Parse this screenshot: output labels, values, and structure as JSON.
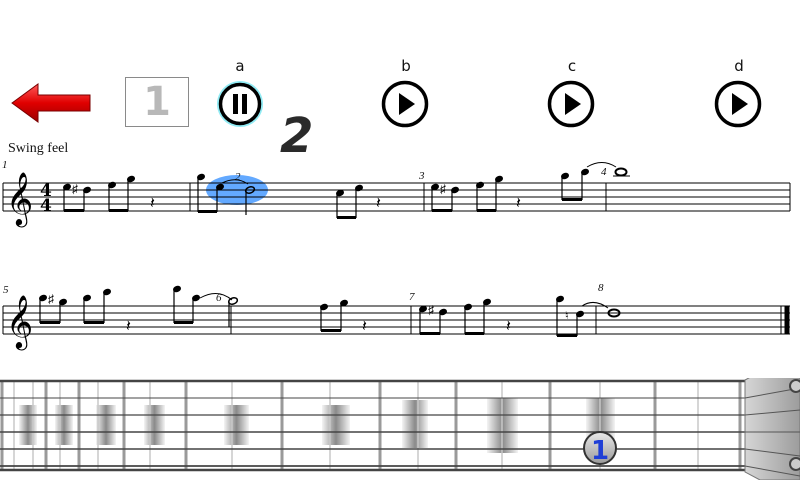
{
  "toolbar": {
    "back_icon": "left-arrow-icon",
    "counter_value": "1",
    "big_number": "2"
  },
  "options": [
    {
      "label": "a",
      "state": "pause",
      "icon": "pause-icon"
    },
    {
      "label": "b",
      "state": "play",
      "icon": "play-icon"
    },
    {
      "label": "c",
      "state": "play",
      "icon": "play-icon"
    },
    {
      "label": "d",
      "state": "play",
      "icon": "play-icon"
    }
  ],
  "score": {
    "tempo_text": "Swing feel",
    "time_signature": {
      "top": "4",
      "bottom": "4"
    },
    "measure_numbers": [
      "1",
      "2",
      "3",
      "4",
      "5",
      "6",
      "7",
      "8"
    ],
    "highlight_color": "#2f8cff"
  },
  "fretboard": {
    "finger_marker": "1",
    "marker_color": "#1f3fd6"
  }
}
